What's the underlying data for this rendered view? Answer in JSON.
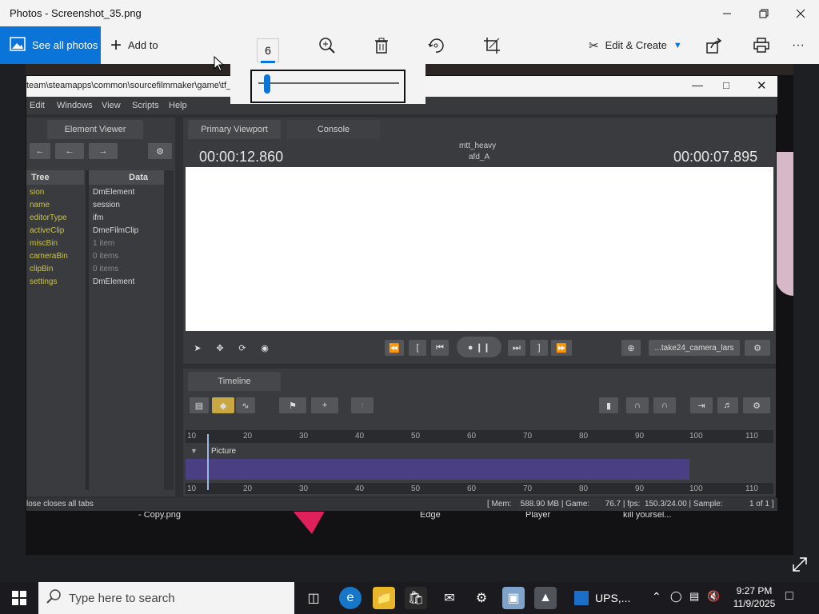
{
  "app": {
    "title": "Photos - Screenshot_35.png",
    "toolbar": {
      "see_all_photos": "See all photos",
      "add_to": "Add to",
      "zoom_value": "6",
      "edit_create": "Edit & Create",
      "more": "···"
    }
  },
  "sfm": {
    "window_title": "team\\steamapps\\common\\sourcefilmmaker\\game\\tf_                                                                  nx - Source Filmmaker [Beta]",
    "menu": [
      "Edit",
      "Windows",
      "View",
      "Scripts",
      "Help"
    ],
    "element_viewer_tab": "Element Viewer",
    "tree_header": "Tree",
    "data_header": "Data",
    "tree_items": [
      "sion",
      "name",
      "editorType",
      "activeClip",
      "miscBin",
      "cameraBin",
      "clipBin",
      "settings"
    ],
    "data_items": [
      "DmElement",
      "session",
      "ifm",
      "DmeFilmClip",
      "1 item",
      "0 items",
      "0 items",
      "DmElement"
    ],
    "primary_viewport_tab": "Primary Viewport",
    "console_tab": "Console",
    "time_left": "00:00:12.860",
    "time_right": "00:00:07.895",
    "shot_name": "mtt_heavy",
    "shot_sub": "afd_A",
    "camera_select": "...take24_camera_lars",
    "timeline_tab": "Timeline",
    "track_label": "Picture",
    "ruler_labels": [
      "10",
      "20",
      "30",
      "40",
      "50",
      "60",
      "70",
      "80",
      "90",
      "100",
      "110"
    ],
    "status_left": "lose closes all tabs",
    "status_right": "[ Mem:    588.90 MB | Game:       76.7 | fps:  150.3/24.00 | Sample:            1 of 1 ]"
  },
  "desktop_labels": [
    "- Copy.png",
    "Edge",
    "Player",
    "kill yoursel..."
  ],
  "taskbar": {
    "search_placeholder": "Type here to search",
    "active_app_label": "UPS,...",
    "time": "9:27 PM",
    "date": "11/9/2025"
  },
  "colors": {
    "accent": "#0a74d8",
    "sfm_bg": "#2e2f33",
    "tree_text": "#c9c24a",
    "clip_bar": "#4b3f84"
  }
}
